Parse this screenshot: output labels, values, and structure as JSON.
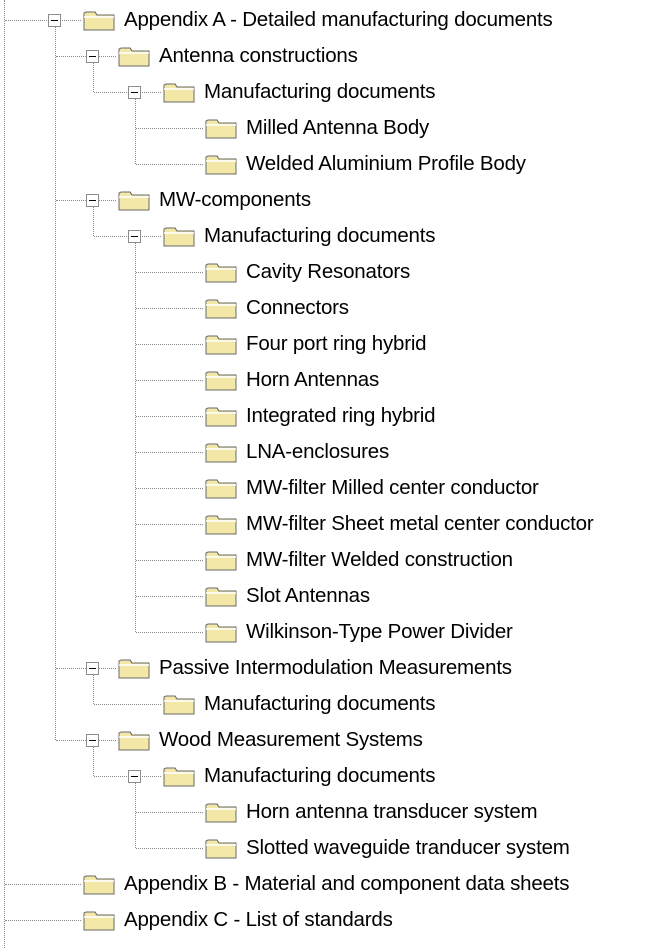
{
  "tree": [
    {
      "label": "Appendix A - Detailed manufacturing documents",
      "level": 0,
      "expanded": true
    },
    {
      "label": "Antenna constructions",
      "level": 1,
      "expanded": true
    },
    {
      "label": "Manufacturing documents",
      "level": 2,
      "expanded": true
    },
    {
      "label": "Milled Antenna Body",
      "level": 3
    },
    {
      "label": "Welded Aluminium Profile Body",
      "level": 3
    },
    {
      "label": "MW-components",
      "level": 1,
      "expanded": true
    },
    {
      "label": "Manufacturing documents",
      "level": 2,
      "expanded": true
    },
    {
      "label": "Cavity Resonators",
      "level": 3
    },
    {
      "label": "Connectors",
      "level": 3
    },
    {
      "label": "Four port ring hybrid",
      "level": 3
    },
    {
      "label": "Horn Antennas",
      "level": 3
    },
    {
      "label": "Integrated ring hybrid",
      "level": 3
    },
    {
      "label": "LNA-enclosures",
      "level": 3
    },
    {
      "label": "MW-filter Milled center conductor",
      "level": 3
    },
    {
      "label": "MW-filter Sheet metal center conductor",
      "level": 3
    },
    {
      "label": "MW-filter Welded construction",
      "level": 3
    },
    {
      "label": "Slot Antennas",
      "level": 3
    },
    {
      "label": "Wilkinson-Type Power Divider",
      "level": 3
    },
    {
      "label": "Passive Intermodulation Measurements",
      "level": 1,
      "expanded": true
    },
    {
      "label": "Manufacturing documents",
      "level": 2
    },
    {
      "label": "Wood Measurement Systems",
      "level": 1,
      "expanded": true
    },
    {
      "label": "Manufacturing documents",
      "level": 2,
      "expanded": true
    },
    {
      "label": "Horn antenna transducer system",
      "level": 3
    },
    {
      "label": "Slotted waveguide tranducer system",
      "level": 3
    },
    {
      "label": "Appendix B - Material and component data sheets",
      "level": 0
    },
    {
      "label": "Appendix C - List of standards",
      "level": 0
    }
  ],
  "colors": {
    "folder_fill": "#f3e8a8",
    "folder_outline": "#6a6a6a",
    "connector": "#8a8a8a"
  },
  "icons": {
    "folder": "folder-icon",
    "collapse": "minus-box-icon"
  }
}
